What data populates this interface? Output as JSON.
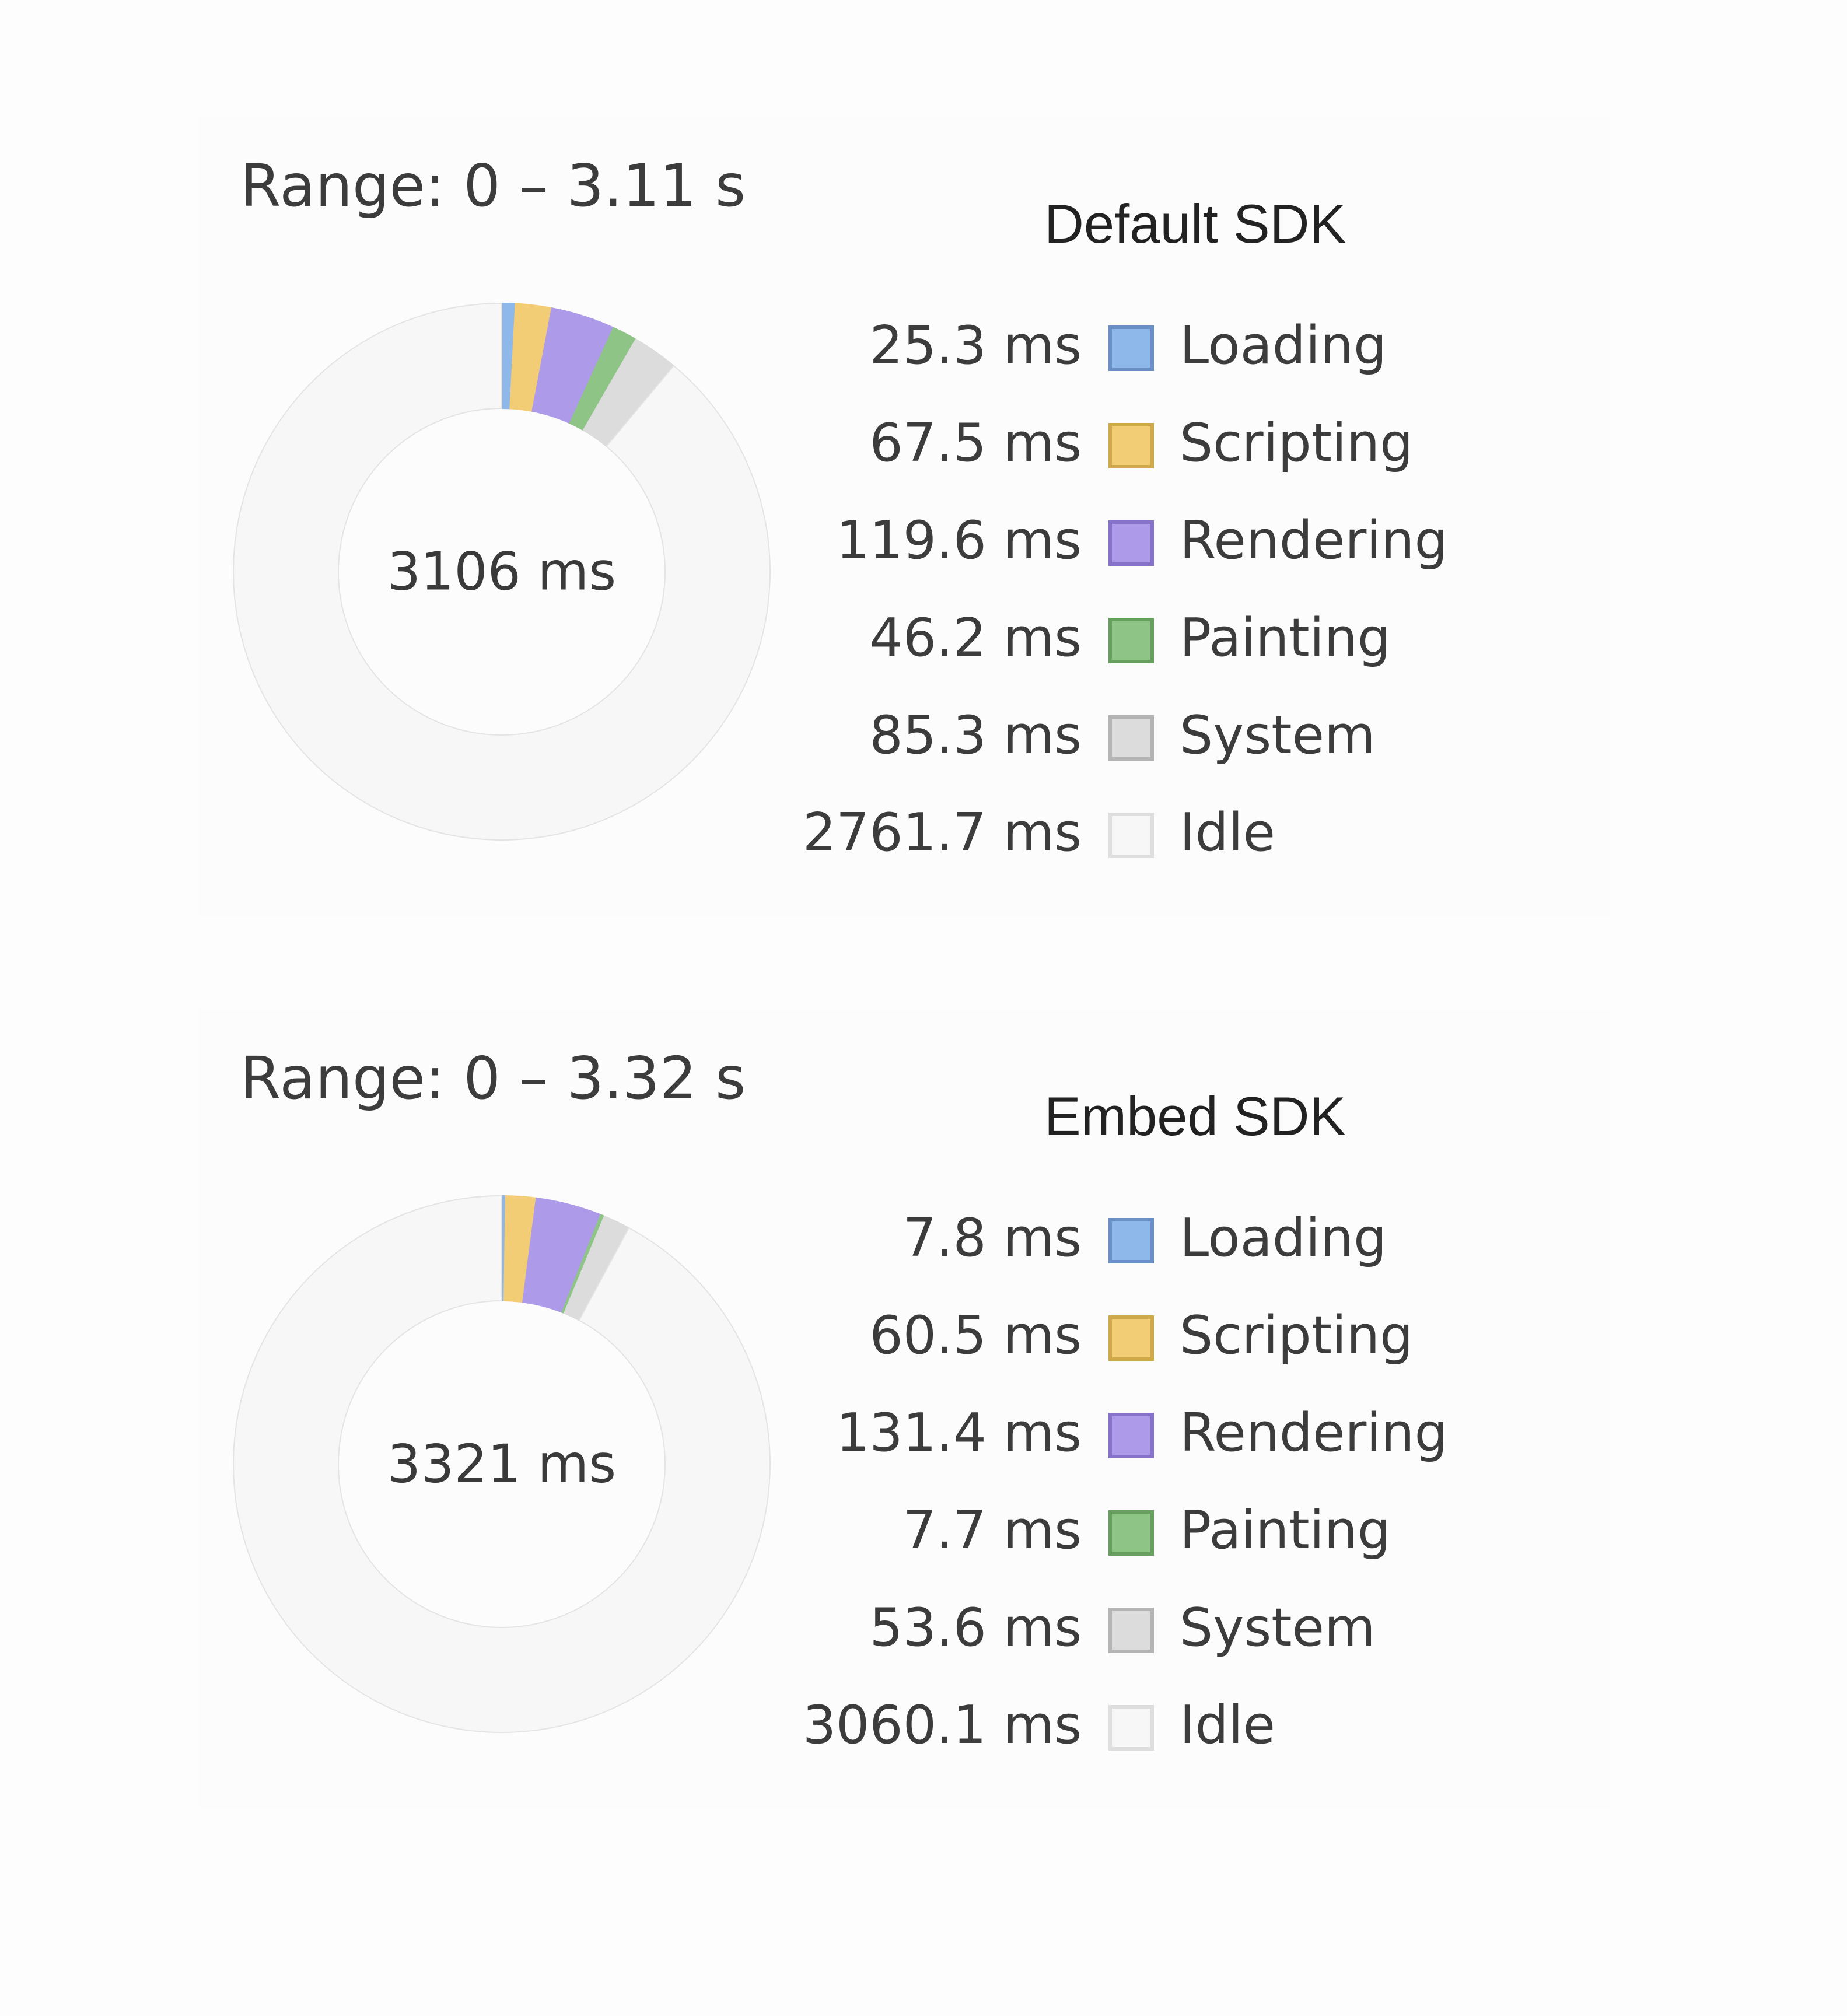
{
  "chart_data": [
    {
      "type": "pie",
      "title": "Default SDK",
      "range_label": "Range: 0 – 3.11 s",
      "total_label": "3106 ms",
      "total": 3106,
      "unit": "ms",
      "legend_position": "right",
      "slices": [
        {
          "label": "Loading",
          "value": 25.3,
          "value_label": "25.3 ms",
          "color": "#8fb8ea",
          "border": "#6a8fc4"
        },
        {
          "label": "Scripting",
          "value": 67.5,
          "value_label": "67.5 ms",
          "color": "#f2cd76",
          "border": "#cfa94a"
        },
        {
          "label": "Rendering",
          "value": 119.6,
          "value_label": "119.6 ms",
          "color": "#ad9be9",
          "border": "#8672c8"
        },
        {
          "label": "Painting",
          "value": 46.2,
          "value_label": "46.2 ms",
          "color": "#8fc487",
          "border": "#67a05e"
        },
        {
          "label": "System",
          "value": 85.3,
          "value_label": "85.3 ms",
          "color": "#dcdcdc",
          "border": "#b4b4b4"
        },
        {
          "label": "Idle",
          "value": 2761.7,
          "value_label": "2761.7 ms",
          "color": "#f7f7f7",
          "border": "#dedede"
        }
      ]
    },
    {
      "type": "pie",
      "title": "Embed SDK",
      "range_label": "Range: 0 – 3.32 s",
      "total_label": "3321 ms",
      "total": 3321,
      "unit": "ms",
      "legend_position": "right",
      "slices": [
        {
          "label": "Loading",
          "value": 7.8,
          "value_label": "7.8 ms",
          "color": "#8fb8ea",
          "border": "#6a8fc4"
        },
        {
          "label": "Scripting",
          "value": 60.5,
          "value_label": "60.5 ms",
          "color": "#f2cd76",
          "border": "#cfa94a"
        },
        {
          "label": "Rendering",
          "value": 131.4,
          "value_label": "131.4 ms",
          "color": "#ad9be9",
          "border": "#8672c8"
        },
        {
          "label": "Painting",
          "value": 7.7,
          "value_label": "7.7 ms",
          "color": "#8fc487",
          "border": "#67a05e"
        },
        {
          "label": "System",
          "value": 53.6,
          "value_label": "53.6 ms",
          "color": "#dcdcdc",
          "border": "#b4b4b4"
        },
        {
          "label": "Idle",
          "value": 3060.1,
          "value_label": "3060.1 ms",
          "color": "#f7f7f7",
          "border": "#dedede"
        }
      ]
    }
  ]
}
